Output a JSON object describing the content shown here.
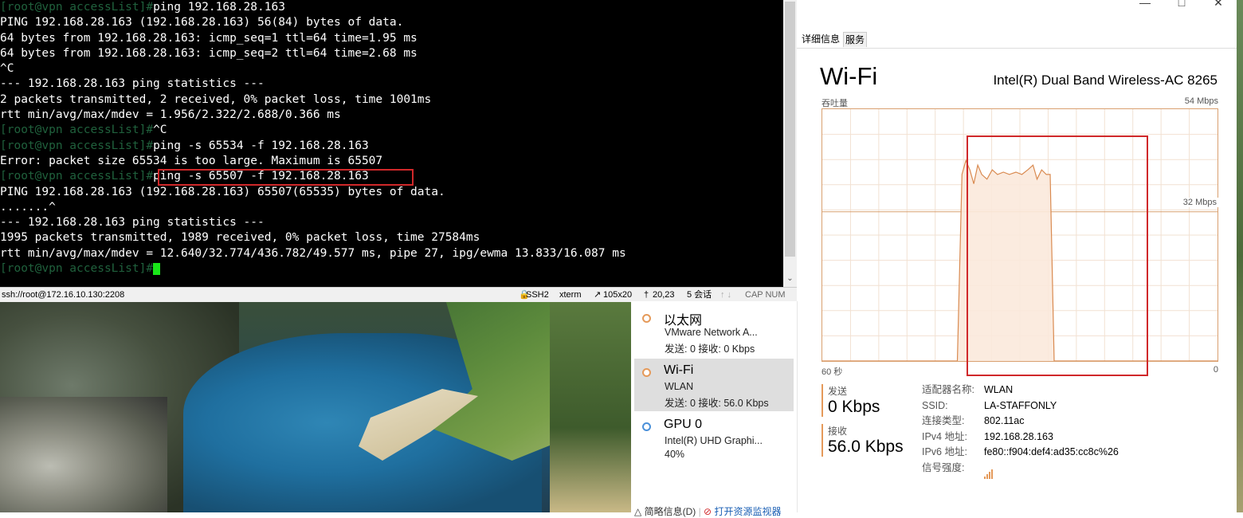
{
  "terminal": {
    "lines": [
      {
        "prompt": "[root@vpn accessList]#",
        "text": "ping 192.168.28.163"
      },
      {
        "prompt": "",
        "text": "PING 192.168.28.163 (192.168.28.163) 56(84) bytes of data."
      },
      {
        "prompt": "",
        "text": "64 bytes from 192.168.28.163: icmp_seq=1 ttl=64 time=1.95 ms"
      },
      {
        "prompt": "",
        "text": "64 bytes from 192.168.28.163: icmp_seq=2 ttl=64 time=2.68 ms"
      },
      {
        "prompt": "",
        "text": "^C"
      },
      {
        "prompt": "",
        "text": "--- 192.168.28.163 ping statistics ---"
      },
      {
        "prompt": "",
        "text": "2 packets transmitted, 2 received, 0% packet loss, time 1001ms"
      },
      {
        "prompt": "",
        "text": "rtt min/avg/max/mdev = 1.956/2.322/2.688/0.366 ms"
      },
      {
        "prompt": "[root@vpn accessList]#",
        "text": "^C"
      },
      {
        "prompt": "[root@vpn accessList]#",
        "text": "ping -s 65534 -f 192.168.28.163"
      },
      {
        "prompt": "",
        "text": "Error: packet size 65534 is too large. Maximum is 65507"
      },
      {
        "prompt": "[root@vpn accessList]#",
        "text": "ping -s 65507 -f 192.168.28.163"
      },
      {
        "prompt": "",
        "text": "PING 192.168.28.163 (192.168.28.163) 65507(65535) bytes of data."
      },
      {
        "prompt": "",
        "text": ".......^"
      },
      {
        "prompt": "",
        "text": "--- 192.168.28.163 ping statistics ---"
      },
      {
        "prompt": "",
        "text": "1995 packets transmitted, 1989 received, 0% packet loss, time 27584ms"
      },
      {
        "prompt": "",
        "text": "rtt min/avg/max/mdev = 12.640/32.774/436.782/49.577 ms, pipe 27, ipg/ewma 13.833/16.087 ms"
      },
      {
        "prompt": "[root@vpn accessList]#",
        "text": ""
      }
    ],
    "status": {
      "conn": "ssh://root@172.16.10.130:2208",
      "proto": "SSH2",
      "term": "xterm",
      "size": "105x20",
      "pos": "20,23",
      "sessions": "5 会话",
      "caps": "CAP NUM"
    }
  },
  "taskmanager": {
    "tabs": [
      "详细信息",
      "服务"
    ],
    "sidebar": [
      {
        "title": "以太网",
        "sub": "VMware Network A...",
        "sub2": "发送: 0 接收: 0 Kbps",
        "selected": false
      },
      {
        "title": "Wi-Fi",
        "sub": "WLAN",
        "sub2": "发送: 0 接收: 56.0 Kbps",
        "selected": true
      },
      {
        "title": "GPU 0",
        "sub": "Intel(R) UHD Graphi...",
        "sub2": "40%",
        "selected": false
      }
    ],
    "footer": {
      "brief": "简略信息(D)",
      "monitor": "打开资源监视器"
    },
    "main": {
      "title": "Wi-Fi",
      "adapter": "Intel(R) Dual Band Wireless-AC 8265",
      "throughput_label": "吞吐量",
      "max_label": "54 Mbps",
      "mid_label": "32 Mbps",
      "time_label": "60 秒",
      "zero_label": "0",
      "send_label": "发送",
      "send_val": "0 Kbps",
      "recv_label": "接收",
      "recv_val": "56.0 Kbps",
      "props": [
        {
          "k": "适配器名称:",
          "v": "WLAN"
        },
        {
          "k": "SSID:",
          "v": "LA-STAFFONLY"
        },
        {
          "k": "连接类型:",
          "v": "802.11ac"
        },
        {
          "k": "IPv4 地址:",
          "v": "192.168.28.163"
        },
        {
          "k": "IPv6 地址:",
          "v": "fe80::f904:def4:ad35:cc8c%26"
        },
        {
          "k": "信号强度:",
          "v": ""
        }
      ]
    }
  },
  "chart_data": {
    "type": "area",
    "title": "",
    "ylabel": "吞吐量",
    "ylim": [
      0,
      54
    ],
    "x": [
      0,
      2,
      4,
      6,
      8,
      10,
      12,
      14,
      16,
      18,
      20,
      22,
      24,
      26,
      28,
      30,
      32,
      34,
      36,
      38,
      40,
      42,
      44,
      46,
      48,
      50,
      52,
      54,
      56,
      58,
      60
    ],
    "series": [
      {
        "values": [
          0,
          0,
          0,
          0,
          0,
          0,
          0,
          0,
          0,
          0,
          0,
          0,
          0,
          0,
          0,
          0,
          0,
          0,
          0,
          0,
          0,
          0,
          0,
          0,
          0,
          0,
          0,
          0,
          0,
          0,
          0
        ]
      }
    ],
    "traffic_curve": [
      [
        0,
        0
      ],
      [
        20.5,
        0
      ],
      [
        21.2,
        40
      ],
      [
        21.8,
        43
      ],
      [
        22.4,
        41
      ],
      [
        23,
        38
      ],
      [
        23.6,
        42
      ],
      [
        24.2,
        40
      ],
      [
        25,
        39
      ],
      [
        25.8,
        41
      ],
      [
        26.6,
        40
      ],
      [
        27.5,
        40.5
      ],
      [
        28.4,
        40
      ],
      [
        29.4,
        40.5
      ],
      [
        30.3,
        40
      ],
      [
        31.2,
        41
      ],
      [
        32,
        42
      ],
      [
        32.6,
        39
      ],
      [
        33.3,
        41
      ],
      [
        34,
        40
      ],
      [
        34.6,
        40
      ],
      [
        35.2,
        0
      ],
      [
        60,
        0
      ]
    ]
  }
}
